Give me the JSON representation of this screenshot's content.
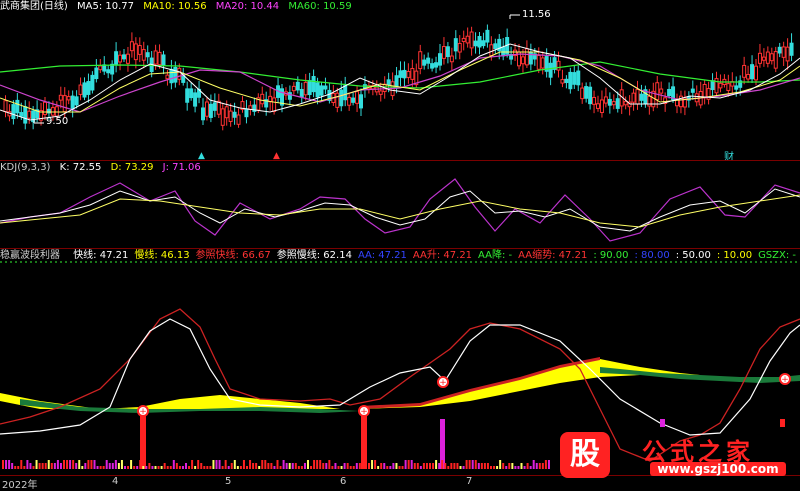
{
  "main": {
    "title": "武商集团(日线)",
    "ma": [
      {
        "label": "MA5: 10.77",
        "color": "#ffffff"
      },
      {
        "label": "MA10: 10.56",
        "color": "#ffff00"
      },
      {
        "label": "MA20: 10.44",
        "color": "#ff44ff"
      },
      {
        "label": "MA60: 10.59",
        "color": "#33ee33"
      }
    ],
    "high_label": "11.56",
    "low_label": "9.50",
    "event_mark": "财"
  },
  "kdj": {
    "title": "KDJ(9,3,3)",
    "k": "K: 72.55",
    "d": "D: 73.29",
    "j": "J: 71.06"
  },
  "ind": {
    "title": "稳赢波段利器",
    "items": [
      {
        "label": "快线: 47.21",
        "color": "#ffffff"
      },
      {
        "label": "慢线: 46.13",
        "color": "#ffff00"
      },
      {
        "label": "参照快线: 66.67",
        "color": "#ff3333"
      },
      {
        "label": "参照慢线: 62.14",
        "color": "#ffffff"
      },
      {
        "label": "AA: 47.21",
        "color": "#3344ff"
      },
      {
        "label": "AA升: 47.21",
        "color": "#ff3333"
      },
      {
        "label": "AA降: -",
        "color": "#33ee33"
      },
      {
        "label": "AA缩势: 47.21",
        "color": "#ff3333"
      },
      {
        "label": ": 90.00",
        "color": "#33ee33"
      },
      {
        "label": ": 80.00",
        "color": "#3344ff"
      },
      {
        "label": ": 50.00",
        "color": "#ffffff"
      },
      {
        "label": ": 10.00",
        "color": "#ffff00"
      },
      {
        "label": "GSZX: -",
        "color": "#33ee33"
      }
    ]
  },
  "axis": {
    "dates": [
      "2022年",
      "4",
      "5",
      "6",
      "7"
    ]
  },
  "watermark": {
    "logo": "股",
    "text": "公式之家",
    "url": "www.gszj100.com"
  },
  "colors": {
    "up": "#ff3333",
    "down": "#33dddd",
    "panel_sep": "#7a0000"
  }
}
